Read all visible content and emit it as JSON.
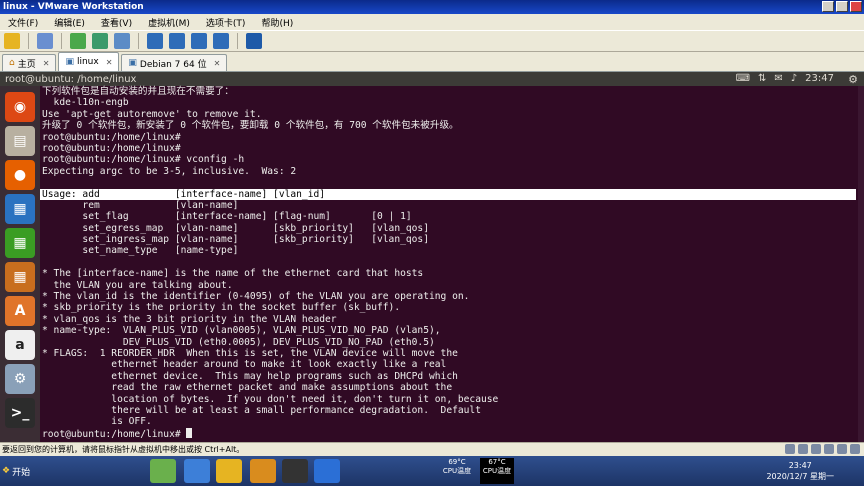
{
  "window": {
    "title": "linux - VMware Workstation"
  },
  "menu": [
    "文件(F)",
    "编辑(E)",
    "查看(V)",
    "虚拟机(M)",
    "选项卡(T)",
    "帮助(H)"
  ],
  "tabs": [
    {
      "label": "主页"
    },
    {
      "label": "linux"
    },
    {
      "label": "Debian 7 64 位"
    }
  ],
  "ubuntu_panel": {
    "title": "root@ubuntu: /home/linux",
    "time": "23:47"
  },
  "launcher": [
    {
      "icon": "ubuntu-dash-icon",
      "color": "#dd4814"
    },
    {
      "icon": "files-icon",
      "color": "#b8b0a0"
    },
    {
      "icon": "firefox-icon",
      "color": "#e66000"
    },
    {
      "icon": "writer-icon",
      "color": "#2a72c0"
    },
    {
      "icon": "calc-icon",
      "color": "#3a9d23"
    },
    {
      "icon": "impress-icon",
      "color": "#c86e1e"
    },
    {
      "icon": "software-center-icon",
      "color": "#e0742a"
    },
    {
      "icon": "amazon-icon",
      "color": "#efefef"
    },
    {
      "icon": "settings-icon",
      "color": "#8aa0b8"
    },
    {
      "icon": "terminal-icon",
      "color": "#2c2c2c"
    }
  ],
  "terminal": {
    "lines": [
      "下列软件包是自动安装的并且现在不需要了：",
      "  kde-l10n-engb",
      "Use 'apt-get autoremove' to remove it.",
      "升级了 0 个软件包，新安装了 0 个软件包，要卸载 0 个软件包，有 700 个软件包未被升级。",
      "root@ubuntu:/home/linux#",
      "root@ubuntu:/home/linux#",
      "root@ubuntu:/home/linux# vconfig -h",
      "Expecting argc to be 3-5, inclusive.  Was: 2",
      "",
      "Usage: add             [interface-name] [vlan_id]",
      "       rem             [vlan-name]",
      "       set_flag        [interface-name] [flag-num]       [0 | 1]",
      "       set_egress_map  [vlan-name]      [skb_priority]   [vlan_qos]",
      "       set_ingress_map [vlan-name]      [skb_priority]   [vlan_qos]",
      "       set_name_type   [name-type]",
      "",
      "* The [interface-name] is the name of the ethernet card that hosts",
      "  the VLAN you are talking about.",
      "* The vlan_id is the identifier (0-4095) of the VLAN you are operating on.",
      "* skb_priority is the priority in the socket buffer (sk_buff).",
      "* vlan_qos is the 3 bit priority in the VLAN header",
      "* name-type:  VLAN_PLUS_VID (vlan0005), VLAN_PLUS_VID_NO_PAD (vlan5),",
      "              DEV_PLUS_VID (eth0.0005), DEV_PLUS_VID_NO_PAD (eth0.5)",
      "* FLAGS:  1 REORDER_HDR  When this is set, the VLAN device will move the",
      "            ethernet header around to make it look exactly like a real",
      "            ethernet device.  This may help programs such as DHCPd which",
      "            read the raw ethernet packet and make assumptions about the",
      "            location of bytes.  If you don't need it, don't turn it on, because",
      "            there will be at least a small performance degradation.  Default",
      "            is OFF."
    ],
    "prompt": "root@ubuntu:/home/linux# "
  },
  "statusbar": {
    "text": "要返回到您的计算机，请将鼠标指针从虚拟机中移出或按 Ctrl+Alt。"
  },
  "taskbar": {
    "start": "开始",
    "cpu_temp": "69°C",
    "cpu_temp_label": "CPU温度",
    "cpu_load": "67°C",
    "cpu_load_label": "CPU温度",
    "clock_time": "23:47",
    "clock_date": "2020/12/7 星期一"
  },
  "colors": {
    "terminal_bg": "#300a24",
    "terminal_fg": "#eeeeec",
    "highlight_bg": "#ffffff"
  }
}
